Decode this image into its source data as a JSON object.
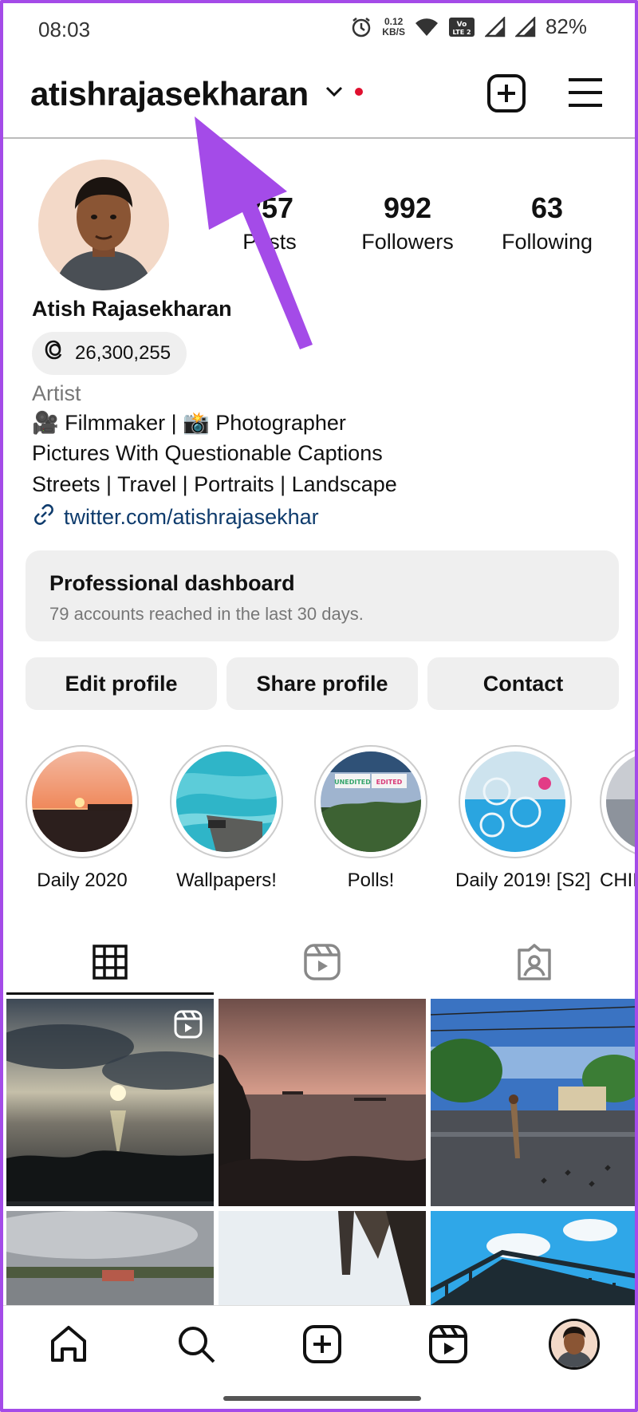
{
  "status_bar": {
    "time": "08:03",
    "speed_value": "0.12",
    "speed_unit": "KB/S",
    "volte": "Vo LTE 2",
    "battery": "82%"
  },
  "header": {
    "username": "atishrajasekharan",
    "notification_color": "#e0102f"
  },
  "profile": {
    "stats": [
      {
        "value": "257",
        "label": "Posts"
      },
      {
        "value": "992",
        "label": "Followers"
      },
      {
        "value": "63",
        "label": "Following"
      }
    ],
    "full_name": "Atish Rajasekharan",
    "threads_count": "26,300,255",
    "category": "Artist",
    "bio": [
      "🎥 Filmmaker | 📸 Photographer",
      "Pictures With Questionable Captions",
      "Streets | Travel | Portraits | Landscape"
    ],
    "link": "twitter.com/atishrajasekhar"
  },
  "dashboard": {
    "title": "Professional dashboard",
    "subtitle": "79 accounts reached in the last 30 days."
  },
  "buttons": {
    "edit": "Edit profile",
    "share": "Share profile",
    "contact": "Contact"
  },
  "highlights": [
    {
      "label": "Daily 2020"
    },
    {
      "label": "Wallpapers!"
    },
    {
      "label": "Polls!",
      "overlay_left": "UNEDITED",
      "overlay_right": "EDITED"
    },
    {
      "label": "Daily 2019! [S2]"
    },
    {
      "label": "CHIKI"
    }
  ],
  "tabs": [
    "grid-icon",
    "reels-icon",
    "tagged-icon"
  ],
  "nav": [
    "home-icon",
    "search-icon",
    "create-icon",
    "reels-icon",
    "profile-avatar"
  ],
  "colors": {
    "annotation_arrow": "#a44be8",
    "link": "#0f3c6d"
  }
}
